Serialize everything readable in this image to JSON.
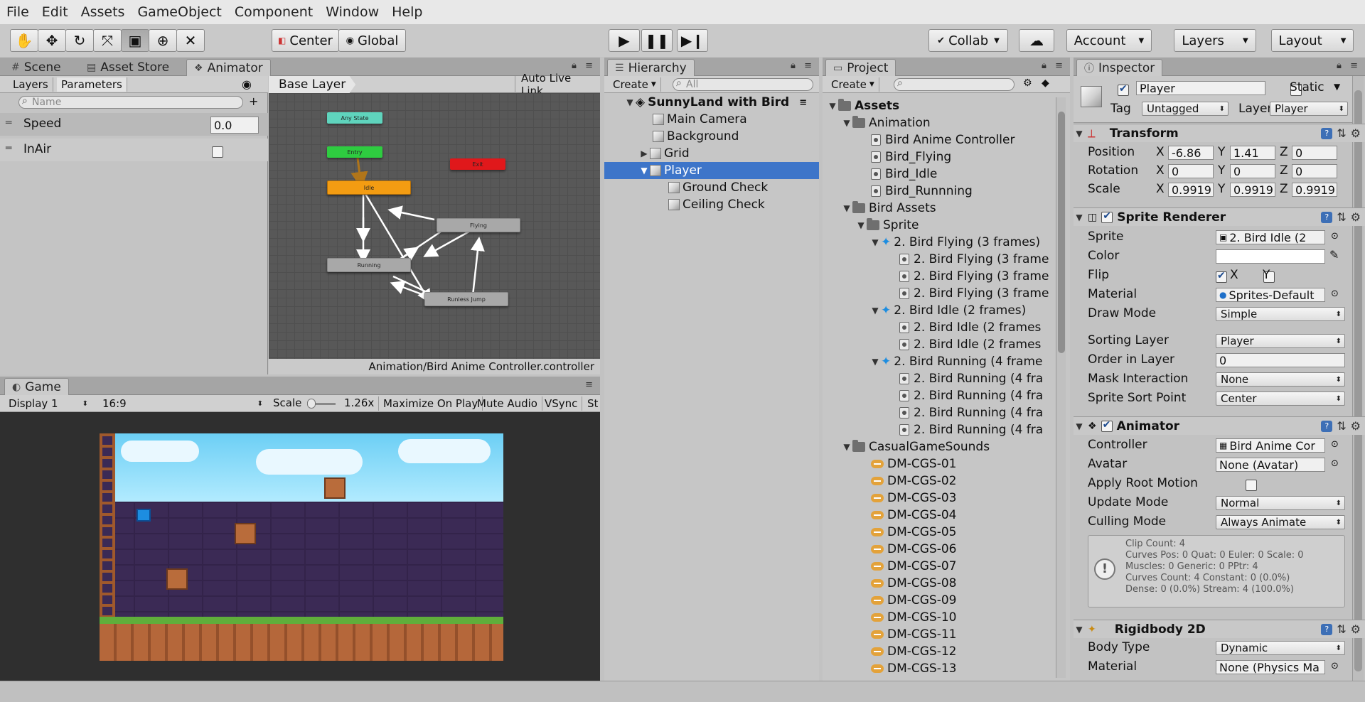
{
  "menu": [
    "File",
    "Edit",
    "Assets",
    "GameObject",
    "Component",
    "Window",
    "Help"
  ],
  "toolbar": {
    "pivot": "Center",
    "space": "Global",
    "collab": "Collab",
    "account": "Account",
    "layers": "Layers",
    "layout": "Layout"
  },
  "scene_tabs": {
    "scene": "Scene",
    "store": "Asset Store",
    "animator": "Animator"
  },
  "animator": {
    "tab_layers": "Layers",
    "tab_parameters": "Parameters",
    "search_placeholder": "Name",
    "params": [
      {
        "name": "Speed",
        "value": "0.0"
      },
      {
        "name": "InAir",
        "value": ""
      }
    ],
    "layer_name": "Base Layer",
    "live_link": "Auto Live Link",
    "states": {
      "any": "Any State",
      "entry": "Entry",
      "exit": "Exit",
      "idle": "Idle",
      "flying": "Flying",
      "running": "Running",
      "runless": "Runless Jump"
    },
    "footer_path": "Animation/Bird Anime Controller.controller"
  },
  "game": {
    "tab": "Game",
    "display": "Display 1",
    "aspect": "16:9",
    "scale_label": "Scale",
    "scale_value": "1.26x",
    "maximize": "Maximize On Play",
    "mute": "Mute Audio",
    "vsync": "VSync",
    "stats": "St"
  },
  "hierarchy": {
    "tab": "Hierarchy",
    "create": "Create",
    "search_placeholder": "All",
    "scene": "SunnyLand with Bird",
    "items": [
      "Main Camera",
      "Background",
      "Grid",
      "Player",
      "Ground Check",
      "Ceiling Check"
    ]
  },
  "project": {
    "tab": "Project",
    "create": "Create",
    "assets": "Assets",
    "animation": "Animation",
    "anim_items": [
      "Bird Anime Controller",
      "Bird_Flying",
      "Bird_Idle",
      "Bird_Runnning"
    ],
    "bird_assets": "Bird Assets",
    "sprite": "Sprite",
    "flying_sheet": "2. Bird Flying (3 frames)",
    "flying_frames": [
      "2. Bird Flying (3 frame",
      "2. Bird Flying (3 frame",
      "2. Bird Flying (3 frame"
    ],
    "idle_sheet": "2. Bird Idle (2 frames)",
    "idle_frames": [
      "2. Bird Idle (2 frames",
      "2. Bird Idle (2 frames"
    ],
    "running_sheet": "2. Bird Running (4 frame",
    "running_frames": [
      "2. Bird Running (4 fra",
      "2. Bird Running (4 fra",
      "2. Bird Running (4 fra",
      "2. Bird Running (4 fra"
    ],
    "sounds_folder": "CasualGameSounds",
    "sounds": [
      "DM-CGS-01",
      "DM-CGS-02",
      "DM-CGS-03",
      "DM-CGS-04",
      "DM-CGS-05",
      "DM-CGS-06",
      "DM-CGS-07",
      "DM-CGS-08",
      "DM-CGS-09",
      "DM-CGS-10",
      "DM-CGS-11",
      "DM-CGS-12",
      "DM-CGS-13"
    ]
  },
  "inspector": {
    "tab": "Inspector",
    "object_name": "Player",
    "static_label": "Static",
    "tag_label": "Tag",
    "tag_value": "Untagged",
    "layer_label": "Layer",
    "layer_value": "Player",
    "transform": {
      "title": "Transform",
      "position_label": "Position",
      "rotation_label": "Rotation",
      "scale_label": "Scale",
      "position": {
        "x": "-6.86",
        "y": "1.41",
        "z": "0"
      },
      "rotation": {
        "x": "0",
        "y": "0",
        "z": "0"
      },
      "scale": {
        "x": "0.9919",
        "y": "0.9919",
        "z": "0.9919"
      }
    },
    "sprite_renderer": {
      "title": "Sprite Renderer",
      "sprite_label": "Sprite",
      "sprite_value": "2. Bird Idle (2",
      "color_label": "Color",
      "flip_label": "Flip",
      "flip_x": "X",
      "flip_y": "Y",
      "material_label": "Material",
      "material_value": "Sprites-Default",
      "draw_mode_label": "Draw Mode",
      "draw_mode_value": "Simple",
      "sorting_layer_label": "Sorting Layer",
      "sorting_layer_value": "Player",
      "order_label": "Order in Layer",
      "order_value": "0",
      "mask_label": "Mask Interaction",
      "mask_value": "None",
      "sort_point_label": "Sprite Sort Point",
      "sort_point_value": "Center"
    },
    "animator": {
      "title": "Animator",
      "controller_label": "Controller",
      "controller_value": "Bird Anime Cor",
      "avatar_label": "Avatar",
      "avatar_value": "None (Avatar)",
      "root_motion_label": "Apply Root Motion",
      "update_label": "Update Mode",
      "update_value": "Normal",
      "culling_label": "Culling Mode",
      "culling_value": "Always Animate",
      "info": [
        "Clip Count: 4",
        "Curves Pos: 0 Quat: 0 Euler: 0 Scale: 0",
        "Muscles: 0 Generic: 0 PPtr: 4",
        "Curves Count: 4 Constant: 0 (0.0%)",
        "Dense: 0 (0.0%) Stream: 4 (100.0%)"
      ]
    },
    "rigidbody": {
      "title": "Rigidbody 2D",
      "body_type_label": "Body Type",
      "body_type_value": "Dynamic",
      "material_label": "Material",
      "material_value": "None (Physics Ma"
    }
  },
  "colors": {
    "selection": "#3d75c9",
    "node_idle": "#f39c12",
    "node_entry": "#2ecc40",
    "node_exit": "#e0181b",
    "node_any": "#5fd4bd"
  }
}
